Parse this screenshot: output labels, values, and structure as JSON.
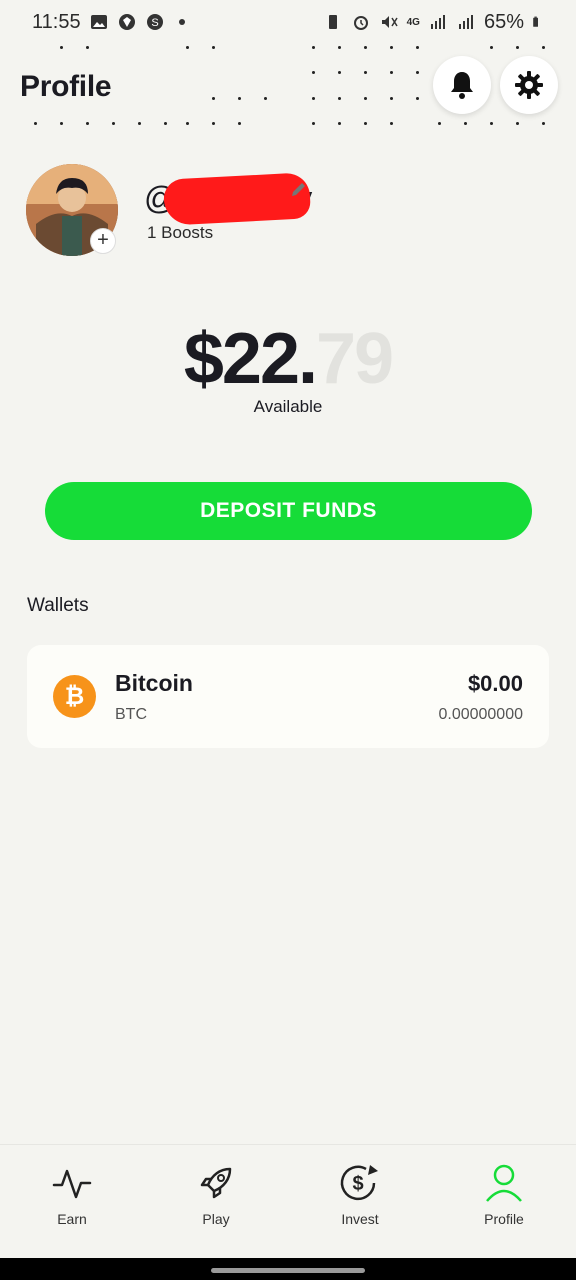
{
  "status_bar": {
    "time": "11:55",
    "left_icons": [
      "gallery-icon",
      "shield-icon",
      "s-app-icon"
    ],
    "right_icons": [
      "battery-saver-icon",
      "alarm-icon",
      "mute-icon",
      "4g-icon",
      "signal-icon",
      "signal-icon"
    ],
    "network": "4G",
    "battery": "65%"
  },
  "header": {
    "title": "Profile",
    "notification_icon": "bell-icon",
    "settings_icon": "gear-icon"
  },
  "profile": {
    "username": "@g",
    "username_tail": "y",
    "boosts": "1 Boosts",
    "avatar_add": "+",
    "edit_icon": "pencil-icon"
  },
  "balance": {
    "dollars": "$22.",
    "cents": "79",
    "label": "Available"
  },
  "deposit": {
    "label": "DEPOSIT FUNDS",
    "color": "#16dc38"
  },
  "wallets": {
    "title": "Wallets",
    "items": [
      {
        "name": "Bitcoin",
        "symbol": "BTC",
        "usd_value": "$0.00",
        "amount": "0.00000000",
        "icon": "bitcoin-icon",
        "icon_glyph": "₿",
        "color": "#f7931a"
      }
    ]
  },
  "nav": {
    "items": [
      {
        "label": "Earn",
        "icon": "activity-icon",
        "active": false
      },
      {
        "label": "Play",
        "icon": "rocket-icon",
        "active": false
      },
      {
        "label": "Invest",
        "icon": "dollar-cycle-icon",
        "active": false
      },
      {
        "label": "Profile",
        "icon": "person-icon",
        "active": true
      }
    ],
    "active_color": "#16dc38"
  }
}
